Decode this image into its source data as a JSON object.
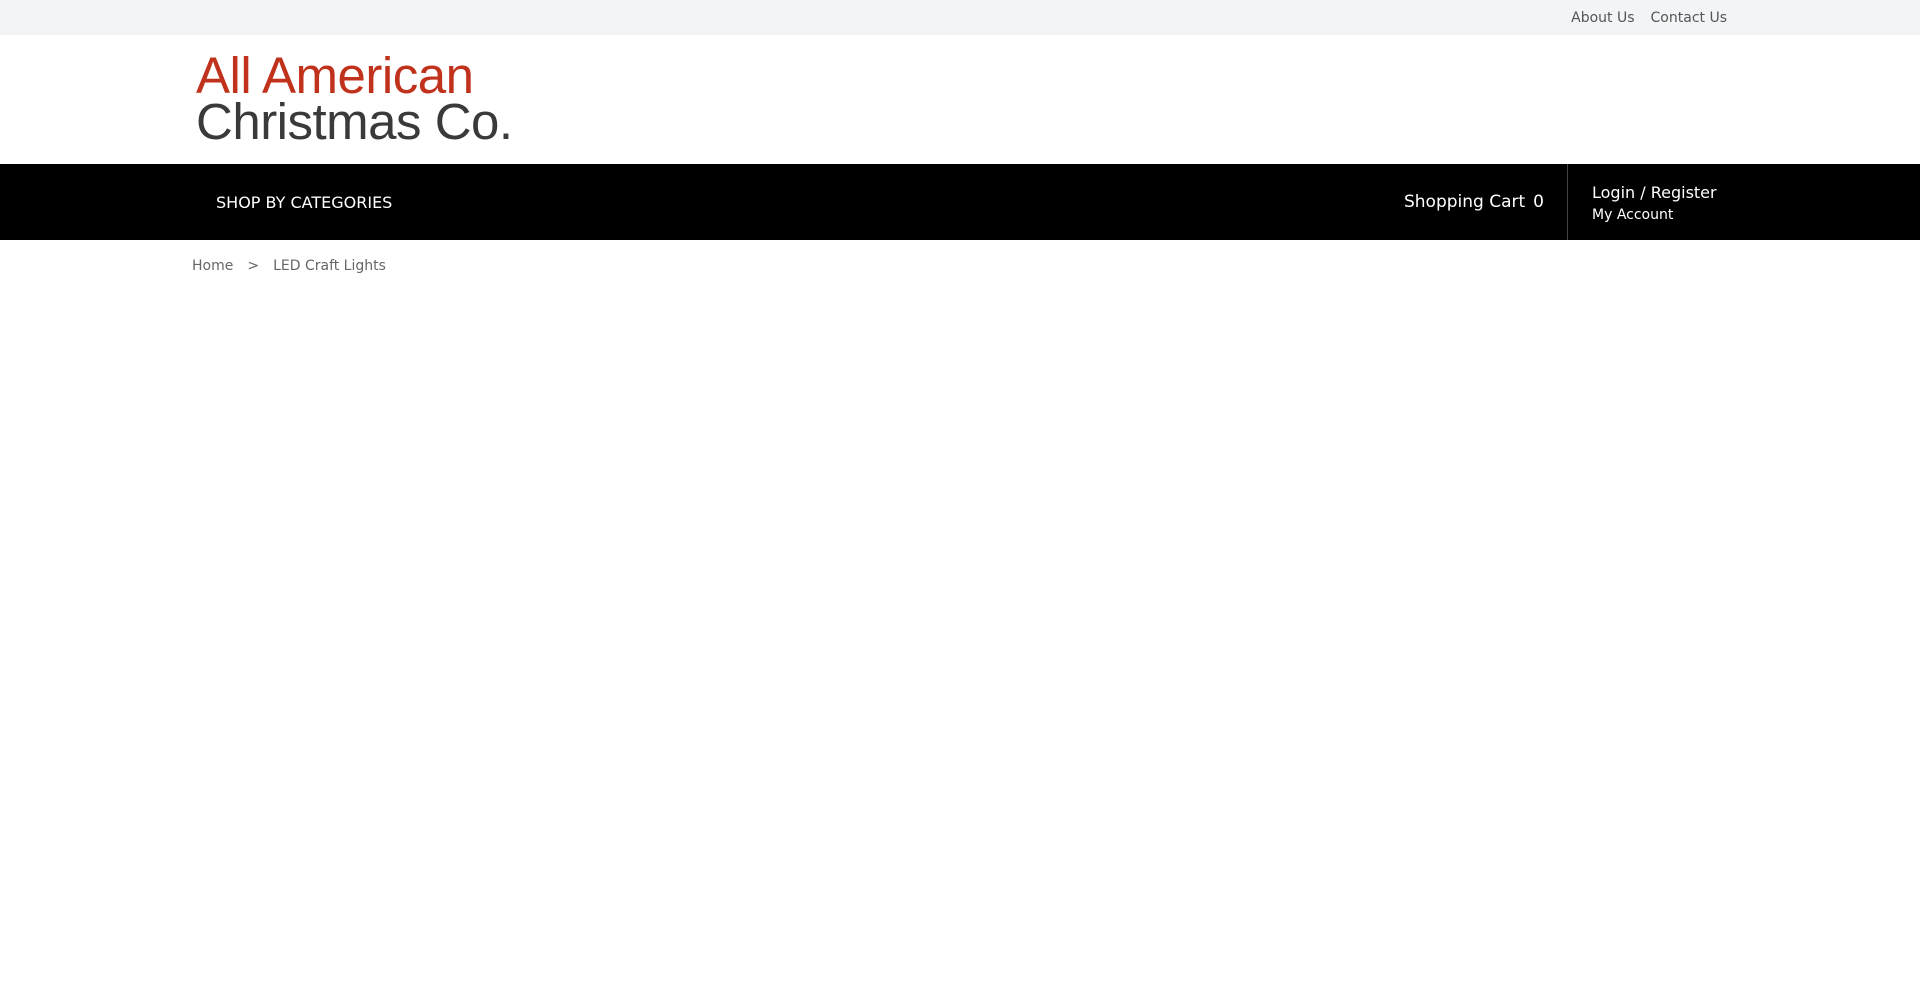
{
  "topbar": {
    "links": [
      "About Us",
      "Contact Us"
    ]
  },
  "logo": {
    "line1": "All American",
    "line2": "Christmas Co.",
    "colors": {
      "line1": "#c0321c",
      "line2": "#3a3a3a"
    }
  },
  "navbar": {
    "categories_label": "SHOP BY CATEGORIES",
    "cart_label": "Shopping Cart",
    "cart_count": "0",
    "login_label": "Login / Register",
    "account_label": "My Account"
  },
  "breadcrumb": {
    "home": "Home",
    "separator": ">",
    "current": "LED Craft Lights"
  }
}
